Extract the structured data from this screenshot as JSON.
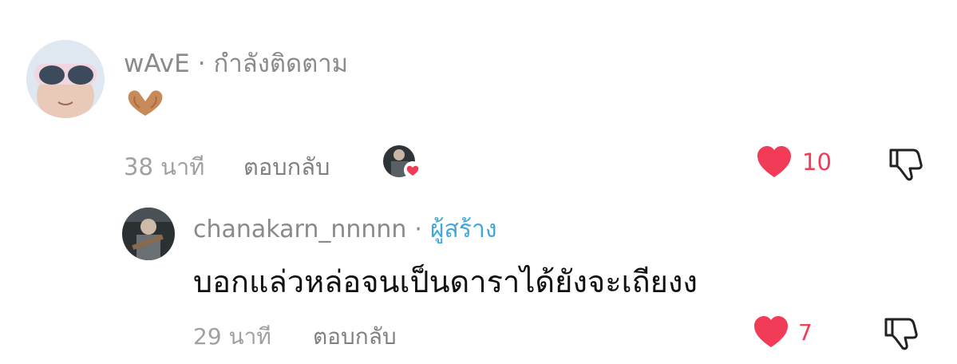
{
  "comment": {
    "username": "wAvE",
    "separator": "·",
    "relationship": "กำลังติดตาม",
    "time": "38 นาที",
    "reply_label": "ตอบกลับ",
    "like_count": "10",
    "emoji_icon": "heart-hands-emoji",
    "liked_by_creator": true
  },
  "reply": {
    "username": "chanakarn_nnnnn",
    "separator": "·",
    "role": "ผู้สร้าง",
    "text": "บอกแล่วหล่อจนเป็นดาราได้ยังจะเถียงง",
    "time": "29 นาที",
    "reply_label": "ตอบกลับ",
    "like_count": "7"
  },
  "colors": {
    "like_red": "#f23b56",
    "creator_blue": "#3ea8d8",
    "meta_gray": "#8a8a8a"
  }
}
